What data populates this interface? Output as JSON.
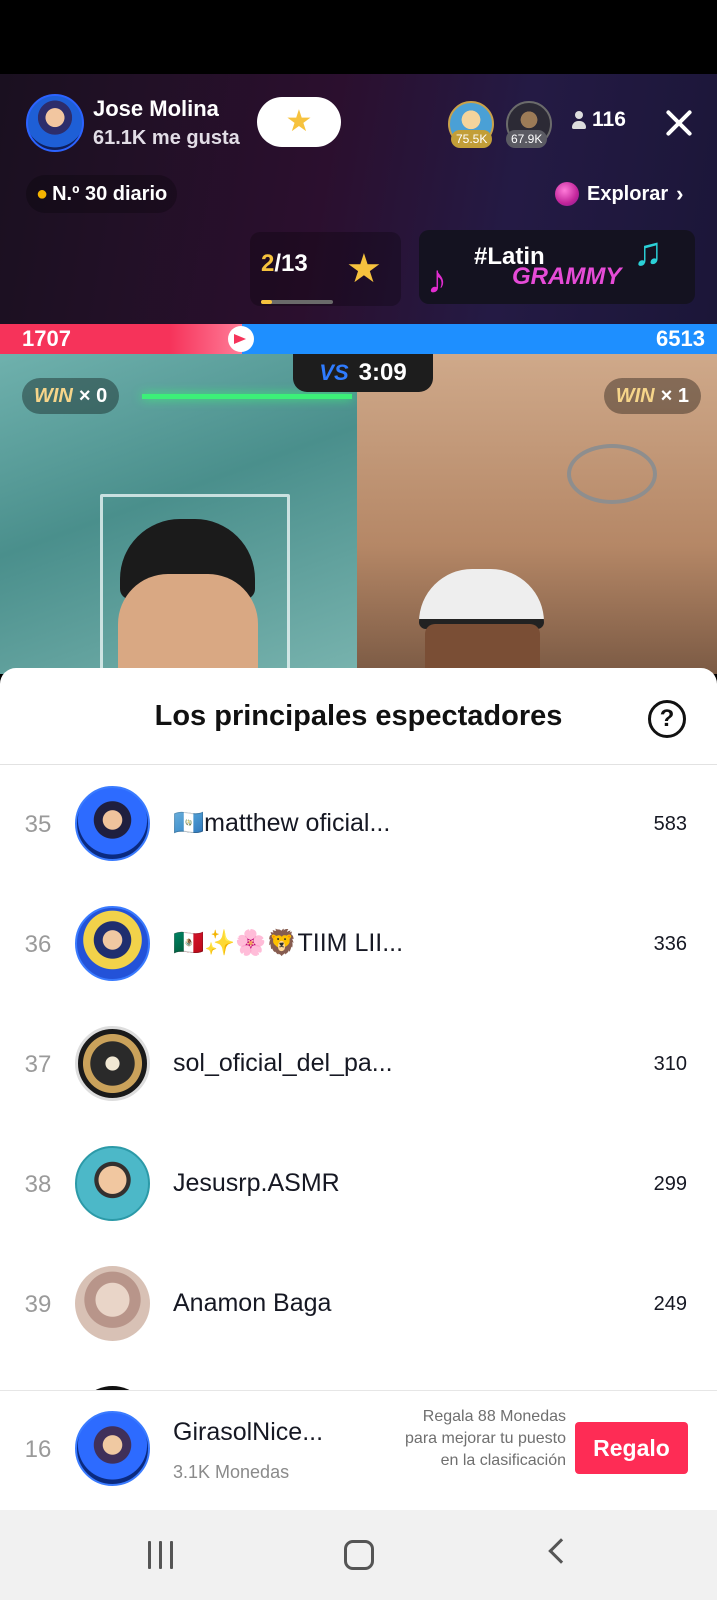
{
  "host": {
    "name": "Jose Molina",
    "likes": "61.1K me gusta",
    "top_viewers": [
      "75.5K",
      "67.9K"
    ],
    "viewer_count": "116"
  },
  "header": {
    "rank_label": "N.º 30 diario",
    "explore_label": "Explorar",
    "goal_current": "2",
    "goal_total": "/13",
    "goal_progress": 0.15,
    "banner_line1": "#Latin",
    "banner_line2": "GRAMMY"
  },
  "battle": {
    "left_score": "1707",
    "right_score": "6513",
    "timer": "3:09",
    "vs_label": "VS",
    "left_win": {
      "label": "WIN",
      "count": "× 0"
    },
    "right_win": {
      "label": "WIN",
      "count": "× 1"
    }
  },
  "sheet": {
    "title": "Los principales espectadores",
    "help_label": "?",
    "rows": [
      {
        "rank": "35",
        "name": "🇬🇹matthew oficial...",
        "score": "583"
      },
      {
        "rank": "36",
        "name": "🇲🇽✨🌸🦁TIIM LII...",
        "score": "336"
      },
      {
        "rank": "37",
        "name": "sol_oficial_del_pa...",
        "score": "310"
      },
      {
        "rank": "38",
        "name": "Jesusrp.ASMR",
        "score": "299"
      },
      {
        "rank": "39",
        "name": "Anamon Baga",
        "score": "249"
      },
      {
        "rank": "",
        "name": "",
        "score": ""
      }
    ]
  },
  "footer": {
    "rank": "16",
    "name": "GirasolNice...",
    "coins": "3.1K Monedas",
    "hint": "Regala 88 Monedas para mejorar tu puesto en la clasificación",
    "gift_label": "Regalo"
  },
  "colors": {
    "accent": "#fe2c55",
    "red_team": "#f6335a",
    "blue_team": "#1e8fff",
    "gold": "#f6c23e"
  },
  "icons": [
    "star-icon",
    "person-icon",
    "close-icon",
    "flame-icon",
    "planet-icon",
    "chevron-right-icon",
    "music-note-icon",
    "help-icon"
  ]
}
